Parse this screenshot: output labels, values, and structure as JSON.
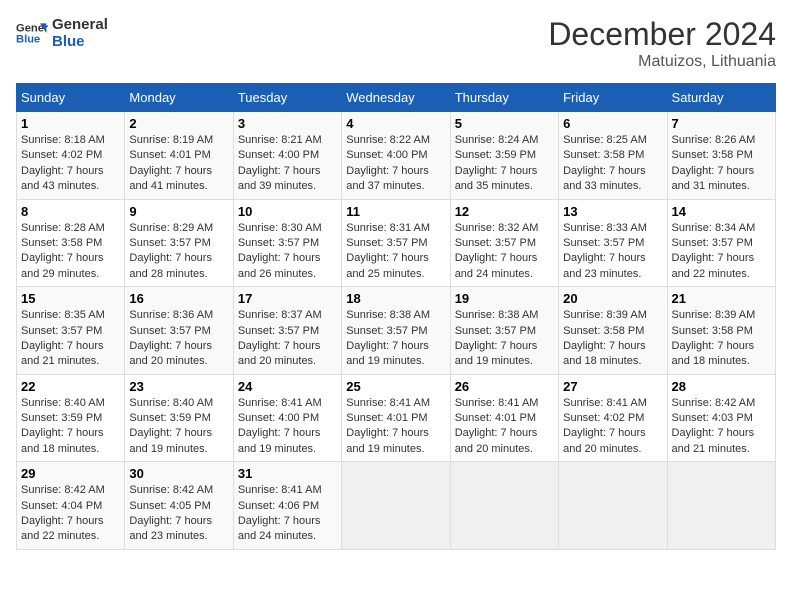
{
  "header": {
    "logo_line1": "General",
    "logo_line2": "Blue",
    "title": "December 2024",
    "subtitle": "Matuizos, Lithuania"
  },
  "days_of_week": [
    "Sunday",
    "Monday",
    "Tuesday",
    "Wednesday",
    "Thursday",
    "Friday",
    "Saturday"
  ],
  "weeks": [
    [
      {
        "day": 1,
        "sunrise": "8:18 AM",
        "sunset": "4:02 PM",
        "daylight": "7 hours and 43 minutes."
      },
      {
        "day": 2,
        "sunrise": "8:19 AM",
        "sunset": "4:01 PM",
        "daylight": "7 hours and 41 minutes."
      },
      {
        "day": 3,
        "sunrise": "8:21 AM",
        "sunset": "4:00 PM",
        "daylight": "7 hours and 39 minutes."
      },
      {
        "day": 4,
        "sunrise": "8:22 AM",
        "sunset": "4:00 PM",
        "daylight": "7 hours and 37 minutes."
      },
      {
        "day": 5,
        "sunrise": "8:24 AM",
        "sunset": "3:59 PM",
        "daylight": "7 hours and 35 minutes."
      },
      {
        "day": 6,
        "sunrise": "8:25 AM",
        "sunset": "3:58 PM",
        "daylight": "7 hours and 33 minutes."
      },
      {
        "day": 7,
        "sunrise": "8:26 AM",
        "sunset": "3:58 PM",
        "daylight": "7 hours and 31 minutes."
      }
    ],
    [
      {
        "day": 8,
        "sunrise": "8:28 AM",
        "sunset": "3:58 PM",
        "daylight": "7 hours and 29 minutes."
      },
      {
        "day": 9,
        "sunrise": "8:29 AM",
        "sunset": "3:57 PM",
        "daylight": "7 hours and 28 minutes."
      },
      {
        "day": 10,
        "sunrise": "8:30 AM",
        "sunset": "3:57 PM",
        "daylight": "7 hours and 26 minutes."
      },
      {
        "day": 11,
        "sunrise": "8:31 AM",
        "sunset": "3:57 PM",
        "daylight": "7 hours and 25 minutes."
      },
      {
        "day": 12,
        "sunrise": "8:32 AM",
        "sunset": "3:57 PM",
        "daylight": "7 hours and 24 minutes."
      },
      {
        "day": 13,
        "sunrise": "8:33 AM",
        "sunset": "3:57 PM",
        "daylight": "7 hours and 23 minutes."
      },
      {
        "day": 14,
        "sunrise": "8:34 AM",
        "sunset": "3:57 PM",
        "daylight": "7 hours and 22 minutes."
      }
    ],
    [
      {
        "day": 15,
        "sunrise": "8:35 AM",
        "sunset": "3:57 PM",
        "daylight": "7 hours and 21 minutes."
      },
      {
        "day": 16,
        "sunrise": "8:36 AM",
        "sunset": "3:57 PM",
        "daylight": "7 hours and 20 minutes."
      },
      {
        "day": 17,
        "sunrise": "8:37 AM",
        "sunset": "3:57 PM",
        "daylight": "7 hours and 20 minutes."
      },
      {
        "day": 18,
        "sunrise": "8:38 AM",
        "sunset": "3:57 PM",
        "daylight": "7 hours and 19 minutes."
      },
      {
        "day": 19,
        "sunrise": "8:38 AM",
        "sunset": "3:57 PM",
        "daylight": "7 hours and 19 minutes."
      },
      {
        "day": 20,
        "sunrise": "8:39 AM",
        "sunset": "3:58 PM",
        "daylight": "7 hours and 18 minutes."
      },
      {
        "day": 21,
        "sunrise": "8:39 AM",
        "sunset": "3:58 PM",
        "daylight": "7 hours and 18 minutes."
      }
    ],
    [
      {
        "day": 22,
        "sunrise": "8:40 AM",
        "sunset": "3:59 PM",
        "daylight": "7 hours and 18 minutes."
      },
      {
        "day": 23,
        "sunrise": "8:40 AM",
        "sunset": "3:59 PM",
        "daylight": "7 hours and 19 minutes."
      },
      {
        "day": 24,
        "sunrise": "8:41 AM",
        "sunset": "4:00 PM",
        "daylight": "7 hours and 19 minutes."
      },
      {
        "day": 25,
        "sunrise": "8:41 AM",
        "sunset": "4:01 PM",
        "daylight": "7 hours and 19 minutes."
      },
      {
        "day": 26,
        "sunrise": "8:41 AM",
        "sunset": "4:01 PM",
        "daylight": "7 hours and 20 minutes."
      },
      {
        "day": 27,
        "sunrise": "8:41 AM",
        "sunset": "4:02 PM",
        "daylight": "7 hours and 20 minutes."
      },
      {
        "day": 28,
        "sunrise": "8:42 AM",
        "sunset": "4:03 PM",
        "daylight": "7 hours and 21 minutes."
      }
    ],
    [
      {
        "day": 29,
        "sunrise": "8:42 AM",
        "sunset": "4:04 PM",
        "daylight": "7 hours and 22 minutes."
      },
      {
        "day": 30,
        "sunrise": "8:42 AM",
        "sunset": "4:05 PM",
        "daylight": "7 hours and 23 minutes."
      },
      {
        "day": 31,
        "sunrise": "8:41 AM",
        "sunset": "4:06 PM",
        "daylight": "7 hours and 24 minutes."
      },
      null,
      null,
      null,
      null
    ]
  ]
}
